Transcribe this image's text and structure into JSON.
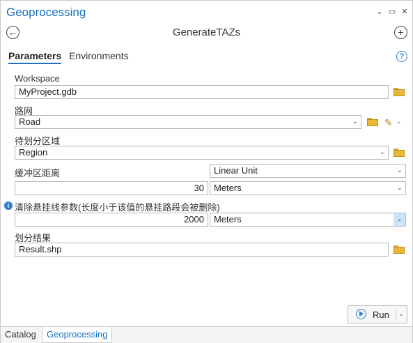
{
  "pane": {
    "title": "Geoprocessing",
    "dropdown_glyph": "⌄",
    "pin_glyph": "▭",
    "close_glyph": "✕"
  },
  "tool": {
    "back_glyph": "←",
    "name": "GenerateTAZs",
    "add_glyph": "+"
  },
  "tabs": {
    "parameters": "Parameters",
    "environments": "Environments",
    "help_glyph": "?"
  },
  "params": {
    "workspace": {
      "label": "Workspace",
      "value": "MyProject.gdb"
    },
    "road": {
      "label": "路网",
      "value": "Road"
    },
    "region": {
      "label": "待划分区域",
      "value": "Region"
    },
    "buffer": {
      "label": "缓冲区距离",
      "unit_type": "Linear Unit",
      "value": "30",
      "unit": "Meters"
    },
    "dangle": {
      "label": "清除悬挂线参数(长度小于该值的悬挂路段会被删除)",
      "value": "2000",
      "unit": "Meters",
      "info_glyph": "i"
    },
    "result": {
      "label": "划分结果",
      "value": "Result.shp"
    }
  },
  "dropdown_glyph": "⌄",
  "run": {
    "label": "Run"
  },
  "bottom_tabs": {
    "catalog": "Catalog",
    "geoprocessing": "Geoprocessing"
  },
  "icons": {
    "folder": "folder-icon",
    "pencil": "pencil-icon",
    "info": "info-icon",
    "help": "help-icon",
    "run": "play-circle-icon"
  },
  "colors": {
    "accent": "#1a70c2",
    "info": "#2d7fd1",
    "folder": "#e8b836"
  }
}
